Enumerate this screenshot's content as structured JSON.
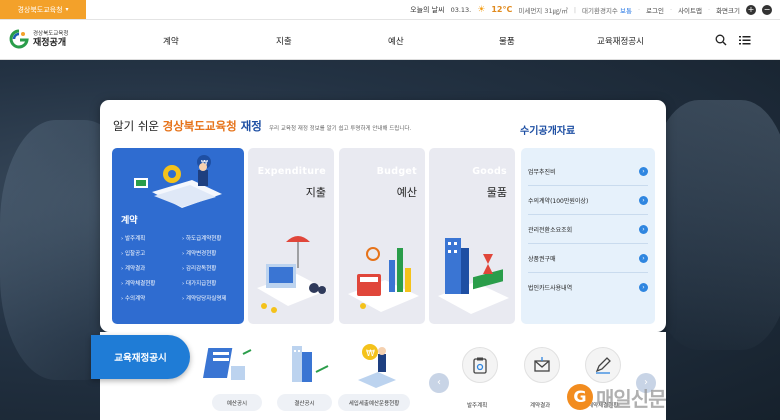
{
  "region_tab": {
    "label": "경상북도교육청",
    "caret": "▾"
  },
  "utility": {
    "weather_label": "오늘의 날씨",
    "date": "03.13.",
    "temperature": "12°C",
    "dust_label": "미세먼지",
    "dust_value": "31㎍/㎥",
    "air_label": "대기환경지수",
    "air_value": "보통",
    "login": "로그인",
    "sitemap": "사이트맵",
    "screen_size": "화면크기",
    "zoom_in": "+",
    "zoom_out": "−"
  },
  "logo": {
    "org": "경상북도교육청",
    "title": "재정공개"
  },
  "nav": [
    "계약",
    "지출",
    "예산",
    "물품",
    "교육재정공시"
  ],
  "card": {
    "title_prefix": "알기 쉬운 ",
    "title_org": "경상북도교육청",
    "title_suffix": " 재정",
    "subtitle": "우리 교육청 재정 정보를 알기 쉽고 투명하게 안내해 드립니다.",
    "contract": {
      "title": "계약",
      "links": [
        "발주계획",
        "하도급계약현황",
        "입찰공고",
        "계약변경현황",
        "계약결과",
        "감리감독현황",
        "계약체결현황",
        "대가지급현황",
        "수의계약",
        "계약담당자실명제"
      ]
    },
    "tiles": [
      {
        "en": "Expenditure",
        "ko": "지출"
      },
      {
        "en": "Budget",
        "ko": "예산"
      },
      {
        "en": "Goods",
        "ko": "물품"
      }
    ],
    "records_title": "수기공개자료",
    "records": [
      "업무추진비",
      "수의계약(100만원이상)",
      "관리전환소요조회",
      "상품권구매",
      "법인카드사용내역"
    ]
  },
  "edu": {
    "button": "교육재정공시",
    "pills": [
      "예산공시",
      "결산공시",
      "세입세출예산운용현황"
    ],
    "round_items": [
      "발주계획",
      "계약결과",
      "계약체결현황"
    ]
  },
  "watermark": {
    "letter": "G",
    "text": "매일신문"
  },
  "colors": {
    "accent_orange": "#f3a12a",
    "primary_blue": "#2f6cd0",
    "title_blue": "#1e4fa3"
  }
}
